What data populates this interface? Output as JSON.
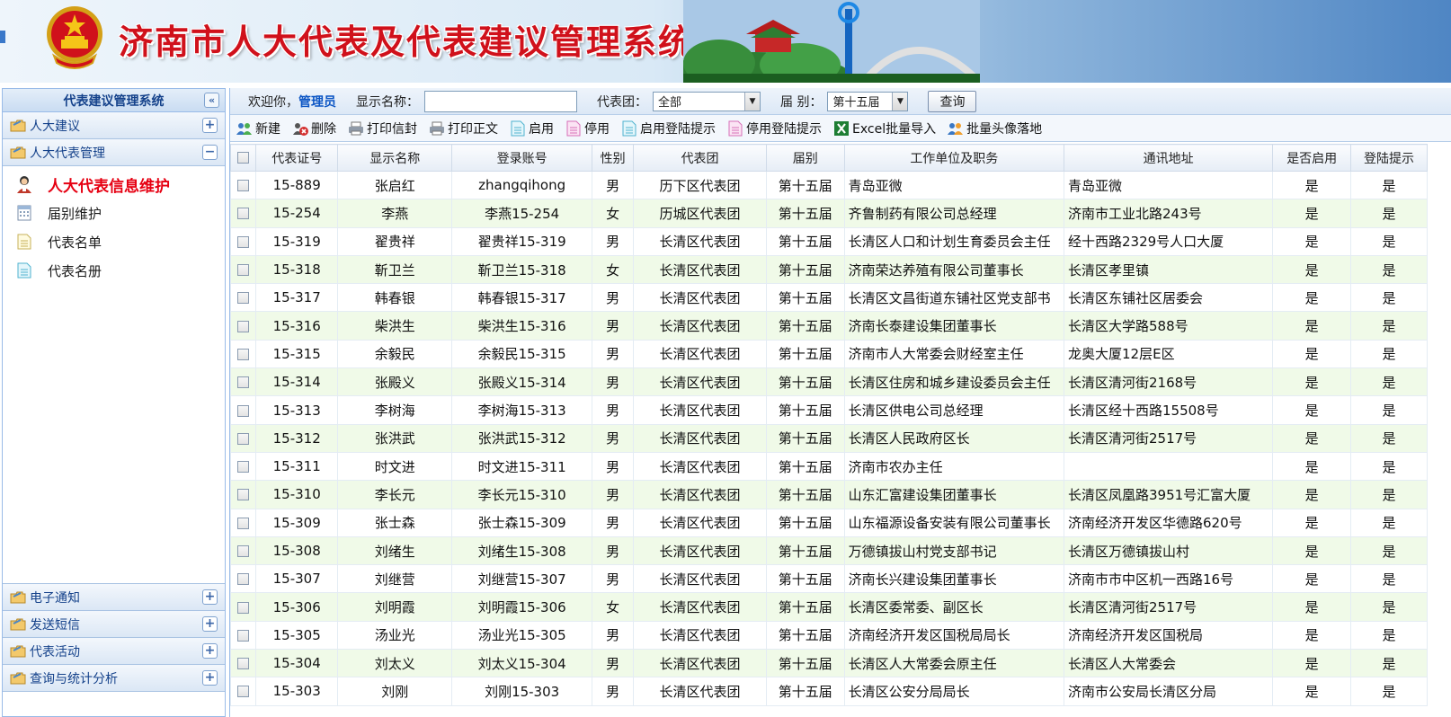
{
  "banner": {
    "title": "济南市人大代表及代表建议管理系统"
  },
  "sidebar": {
    "header": "代表建议管理系统",
    "panels_top": [
      {
        "label": "人大建议",
        "state": "+"
      },
      {
        "label": "人大代表管理",
        "state": "−"
      }
    ],
    "items": [
      {
        "label": "人大代表信息维护",
        "icon": "user-icon",
        "active": true
      },
      {
        "label": "届别维护",
        "icon": "calendar-icon"
      },
      {
        "label": "代表名单",
        "icon": "document-icon"
      },
      {
        "label": "代表名册",
        "icon": "document-icon"
      }
    ],
    "panels_bottom": [
      {
        "label": "电子通知",
        "state": "+"
      },
      {
        "label": "发送短信",
        "state": "+"
      },
      {
        "label": "代表活动",
        "state": "+"
      },
      {
        "label": "查询与统计分析",
        "state": "+"
      }
    ]
  },
  "filter": {
    "welcome": "欢迎你，",
    "user": "管理员",
    "name_label": "显示名称：",
    "name_value": "",
    "group_label": "代表团：",
    "group_value": "全部",
    "session_label": "届 别：",
    "session_value": "第十五届",
    "query": "查询"
  },
  "toolbar": [
    {
      "label": "新建",
      "icon": "users-add-icon"
    },
    {
      "label": "删除",
      "icon": "delete-icon"
    },
    {
      "label": "打印信封",
      "icon": "printer-icon"
    },
    {
      "label": "打印正文",
      "icon": "printer-icon"
    },
    {
      "label": "启用",
      "icon": "enable-doc-icon"
    },
    {
      "label": "停用",
      "icon": "disable-doc-icon"
    },
    {
      "label": "启用登陆提示",
      "icon": "enable-doc-icon"
    },
    {
      "label": "停用登陆提示",
      "icon": "disable-doc-icon"
    },
    {
      "label": "Excel批量导入",
      "icon": "excel-icon"
    },
    {
      "label": "批量头像落地",
      "icon": "users-icon"
    }
  ],
  "table": {
    "columns": [
      "代表证号",
      "显示名称",
      "登录账号",
      "性别",
      "代表团",
      "届别",
      "工作单位及职务",
      "通讯地址",
      "是否启用",
      "登陆提示"
    ],
    "rows": [
      [
        "15-889",
        "张启红",
        "zhangqihong",
        "男",
        "历下区代表团",
        "第十五届",
        "青岛亚微",
        "青岛亚微",
        "是",
        "是"
      ],
      [
        "15-254",
        "李燕",
        "李燕15-254",
        "女",
        "历城区代表团",
        "第十五届",
        "齐鲁制药有限公司总经理",
        "济南市工业北路243号",
        "是",
        "是"
      ],
      [
        "15-319",
        "翟贵祥",
        "翟贵祥15-319",
        "男",
        "长清区代表团",
        "第十五届",
        "长清区人口和计划生育委员会主任",
        "经十西路2329号人口大厦",
        "是",
        "是"
      ],
      [
        "15-318",
        "靳卫兰",
        "靳卫兰15-318",
        "女",
        "长清区代表团",
        "第十五届",
        "济南荣达养殖有限公司董事长",
        "长清区孝里镇",
        "是",
        "是"
      ],
      [
        "15-317",
        "韩春银",
        "韩春银15-317",
        "男",
        "长清区代表团",
        "第十五届",
        "长清区文昌街道东铺社区党支部书",
        "长清区东铺社区居委会",
        "是",
        "是"
      ],
      [
        "15-316",
        "柴洪生",
        "柴洪生15-316",
        "男",
        "长清区代表团",
        "第十五届",
        "济南长泰建设集团董事长",
        "长清区大学路588号",
        "是",
        "是"
      ],
      [
        "15-315",
        "余毅民",
        "余毅民15-315",
        "男",
        "长清区代表团",
        "第十五届",
        "济南市人大常委会财经室主任",
        "龙奥大厦12层E区",
        "是",
        "是"
      ],
      [
        "15-314",
        "张殿义",
        "张殿义15-314",
        "男",
        "长清区代表团",
        "第十五届",
        "长清区住房和城乡建设委员会主任",
        "长清区清河街2168号",
        "是",
        "是"
      ],
      [
        "15-313",
        "李树海",
        "李树海15-313",
        "男",
        "长清区代表团",
        "第十五届",
        "长清区供电公司总经理",
        "长清区经十西路15508号",
        "是",
        "是"
      ],
      [
        "15-312",
        "张洪武",
        "张洪武15-312",
        "男",
        "长清区代表团",
        "第十五届",
        "长清区人民政府区长",
        "长清区清河街2517号",
        "是",
        "是"
      ],
      [
        "15-311",
        "时文进",
        "时文进15-311",
        "男",
        "长清区代表团",
        "第十五届",
        "济南市农办主任",
        "",
        "是",
        "是"
      ],
      [
        "15-310",
        "李长元",
        "李长元15-310",
        "男",
        "长清区代表团",
        "第十五届",
        "山东汇富建设集团董事长",
        "长清区凤凰路3951号汇富大厦",
        "是",
        "是"
      ],
      [
        "15-309",
        "张士森",
        "张士森15-309",
        "男",
        "长清区代表团",
        "第十五届",
        "山东福源设备安装有限公司董事长",
        "济南经济开发区华德路620号",
        "是",
        "是"
      ],
      [
        "15-308",
        "刘绪生",
        "刘绪生15-308",
        "男",
        "长清区代表团",
        "第十五届",
        "万德镇拔山村党支部书记",
        "长清区万德镇拔山村",
        "是",
        "是"
      ],
      [
        "15-307",
        "刘继营",
        "刘继营15-307",
        "男",
        "长清区代表团",
        "第十五届",
        "济南长兴建设集团董事长",
        "济南市市中区机一西路16号",
        "是",
        "是"
      ],
      [
        "15-306",
        "刘明霞",
        "刘明霞15-306",
        "女",
        "长清区代表团",
        "第十五届",
        "长清区委常委、副区长",
        "长清区清河街2517号",
        "是",
        "是"
      ],
      [
        "15-305",
        "汤业光",
        "汤业光15-305",
        "男",
        "长清区代表团",
        "第十五届",
        "济南经济开发区国税局局长",
        "济南经济开发区国税局",
        "是",
        "是"
      ],
      [
        "15-304",
        "刘太义",
        "刘太义15-304",
        "男",
        "长清区代表团",
        "第十五届",
        "长清区人大常委会原主任",
        "长清区人大常委会",
        "是",
        "是"
      ],
      [
        "15-303",
        "刘刚",
        "刘刚15-303",
        "男",
        "长清区代表团",
        "第十五届",
        "长清区公安分局局长",
        "济南市公安局长清区分局",
        "是",
        "是"
      ]
    ]
  }
}
